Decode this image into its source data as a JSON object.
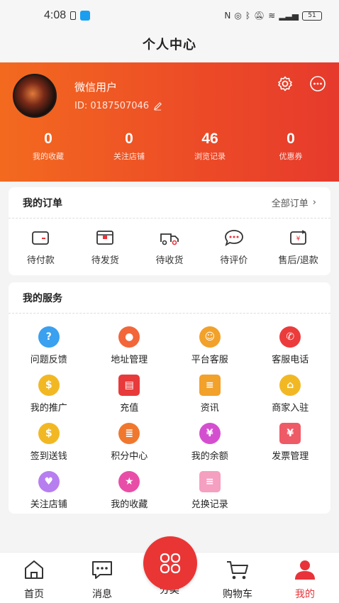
{
  "status_bar": {
    "time": "4:08",
    "battery": "51"
  },
  "page_title": "个人中心",
  "profile": {
    "username": "微信用户",
    "id_text": "ID:  0187507046",
    "stats": [
      {
        "value": "0",
        "label": "我的收藏"
      },
      {
        "value": "0",
        "label": "关注店铺"
      },
      {
        "value": "46",
        "label": "浏览记录"
      },
      {
        "value": "0",
        "label": "优惠券"
      }
    ]
  },
  "orders": {
    "title": "我的订单",
    "all_label": "全部订单",
    "items": [
      {
        "label": "待付款",
        "icon": "wallet-icon"
      },
      {
        "label": "待发货",
        "icon": "package-icon"
      },
      {
        "label": "待收货",
        "icon": "truck-icon"
      },
      {
        "label": "待评价",
        "icon": "comment-icon"
      },
      {
        "label": "售后/退款",
        "icon": "refund-icon"
      }
    ]
  },
  "services": {
    "title": "我的服务",
    "items": [
      {
        "label": "问题反馈",
        "icon": "question-icon",
        "color": "#3aa0f0"
      },
      {
        "label": "地址管理",
        "icon": "location-icon",
        "color": "#f2663a"
      },
      {
        "label": "平台客服",
        "icon": "service-agent-icon",
        "color": "#f2a12a"
      },
      {
        "label": "客服电话",
        "icon": "phone-icon",
        "color": "#ec3b3b"
      },
      {
        "label": "我的推广",
        "icon": "promotion-icon",
        "color": "#f2b824"
      },
      {
        "label": "充值",
        "icon": "recharge-icon",
        "color": "#e83a3a"
      },
      {
        "label": "资讯",
        "icon": "news-icon",
        "color": "#f2a12a"
      },
      {
        "label": "商家入驻",
        "icon": "store-icon",
        "color": "#f2b824"
      },
      {
        "label": "签到送钱",
        "icon": "checkin-icon",
        "color": "#f2b824"
      },
      {
        "label": "积分中心",
        "icon": "points-icon",
        "color": "#f0782e"
      },
      {
        "label": "我的余额",
        "icon": "balance-icon",
        "color": "#d44fd0"
      },
      {
        "label": "发票管理",
        "icon": "invoice-icon",
        "color": "#ee5a66"
      },
      {
        "label": "关注店铺",
        "icon": "heart-icon",
        "color": "#b77ef0"
      },
      {
        "label": "我的收藏",
        "icon": "star-icon",
        "color": "#e84ea8"
      },
      {
        "label": "兑换记录",
        "icon": "exchange-record-icon",
        "color": "#f5a0c0"
      }
    ]
  },
  "tabbar": {
    "items": [
      {
        "label": "首页",
        "icon": "home-icon"
      },
      {
        "label": "消息",
        "icon": "message-icon"
      },
      {
        "label": "分类",
        "icon": "category-icon"
      },
      {
        "label": "购物车",
        "icon": "cart-icon"
      },
      {
        "label": "我的",
        "icon": "user-icon"
      }
    ],
    "active_color": "#e8333a"
  },
  "colors": {
    "accent": "#e8333a",
    "header_start": "#f36a1f",
    "header_end": "#e63a2c"
  }
}
